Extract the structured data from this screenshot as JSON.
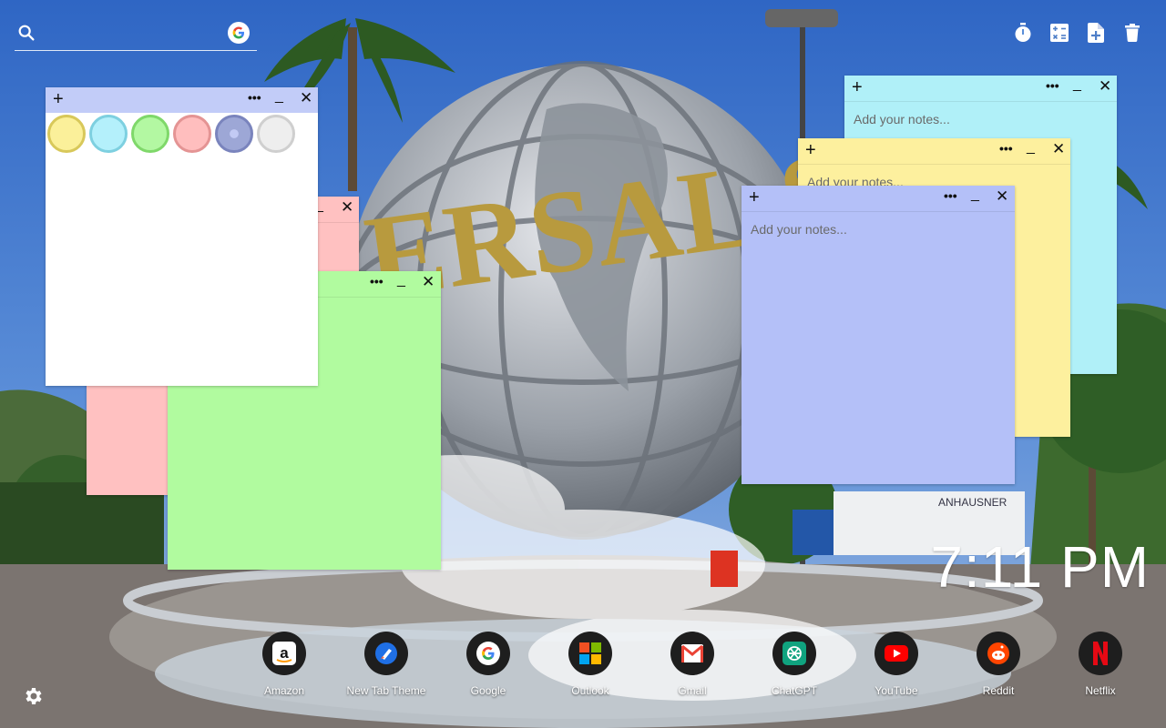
{
  "search": {
    "value": "",
    "placeholder": ""
  },
  "toolbar": {
    "icons": [
      "timer-icon",
      "calculator-icon",
      "new-note-icon",
      "delete-icon"
    ]
  },
  "notes": [
    {
      "id": "cyan",
      "color": "#b0f0f8",
      "placeholder": "Add your notes..."
    },
    {
      "id": "yellow",
      "color": "#fdf09e",
      "placeholder": "Add your notes..."
    },
    {
      "id": "blue",
      "color": "#b4c0f8",
      "placeholder": "Add your notes..."
    },
    {
      "id": "pink",
      "color": "#ffc1c1",
      "placeholder": ""
    },
    {
      "id": "green",
      "color": "#b1fb9f",
      "placeholder": ""
    },
    {
      "id": "white",
      "color": "#ffffff",
      "placeholder": ""
    }
  ],
  "note_controls": {
    "plus": "+",
    "more": "•••",
    "minimize": "_",
    "close": "✕"
  },
  "color_picker": [
    {
      "name": "yellow",
      "fill": "#fbf09a",
      "ring": "#d8c85a"
    },
    {
      "name": "cyan",
      "fill": "#b4f0fb",
      "ring": "#7ed0e0"
    },
    {
      "name": "green",
      "fill": "#b3f8a2",
      "ring": "#7fd86a"
    },
    {
      "name": "pink",
      "fill": "#ffbebe",
      "ring": "#e49494"
    },
    {
      "name": "blue",
      "fill": "#9da7d6",
      "ring": "#7a84bd"
    },
    {
      "name": "white",
      "fill": "#eeeeee",
      "ring": "#cfcfcf"
    }
  ],
  "clock": {
    "time": "7:11 PM"
  },
  "dock": [
    {
      "label": "Amazon",
      "icon": "amazon-icon"
    },
    {
      "label": "New Tab Theme",
      "icon": "new-tab-theme-icon"
    },
    {
      "label": "Google",
      "icon": "google-icon"
    },
    {
      "label": "Outlook",
      "icon": "outlook-icon"
    },
    {
      "label": "Gmail",
      "icon": "gmail-icon"
    },
    {
      "label": "ChatGPT",
      "icon": "chatgpt-icon"
    },
    {
      "label": "YouTube",
      "icon": "youtube-icon"
    },
    {
      "label": "Reddit",
      "icon": "reddit-icon"
    },
    {
      "label": "Netflix",
      "icon": "netflix-icon"
    }
  ],
  "background": {
    "sign_text": "ERSAL ST",
    "truck_text": "ANHAUSNER"
  }
}
